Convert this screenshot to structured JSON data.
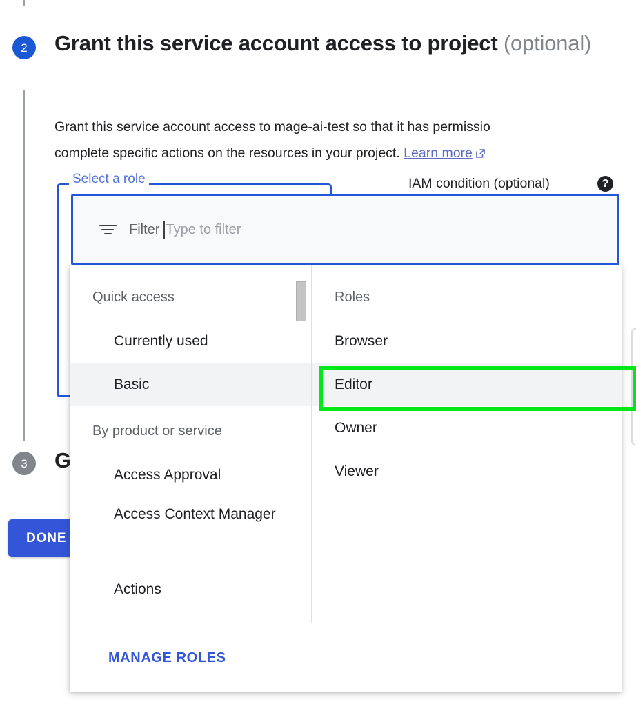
{
  "steps": {
    "step2_number": "2",
    "step3_number": "3",
    "step2_title": "Grant this service account access to project",
    "step2_title_optional": "(optional)",
    "step2_description_line1": "Grant this service account access to mage-ai-test so that it has permissio",
    "step2_description_line2": "complete specific actions on the resources in your project.",
    "learn_more_label": "Learn more",
    "step3_title_visible": "G"
  },
  "role_field": {
    "label": "Select a role",
    "iam_condition_label": "IAM condition (optional)",
    "help_icon": "help-icon"
  },
  "filter": {
    "icon": "filter-icon",
    "label": "Filter",
    "placeholder": "Type to filter",
    "value": ""
  },
  "dropdown": {
    "left_column": {
      "groups": [
        {
          "header": "Quick access",
          "items": [
            {
              "label": "Currently used",
              "selected": false
            },
            {
              "label": "Basic",
              "selected": true
            }
          ]
        },
        {
          "header": "By product or service",
          "items": [
            {
              "label": "Access Approval",
              "selected": false
            },
            {
              "label": "Access Context Manager",
              "selected": false,
              "wrap": true
            },
            {
              "label": "Actions",
              "selected": false
            }
          ]
        }
      ]
    },
    "right_column": {
      "header": "Roles",
      "items": [
        {
          "label": "Browser",
          "selected": false
        },
        {
          "label": "Editor",
          "selected": true
        },
        {
          "label": "Owner",
          "selected": false
        },
        {
          "label": "Viewer",
          "selected": false
        }
      ]
    },
    "footer": {
      "manage_roles_label": "MANAGE ROLES"
    }
  },
  "buttons": {
    "done_label": "DONE"
  },
  "annotation": {
    "highlight_target": "Editor",
    "highlight_color": "#00e818"
  },
  "colors": {
    "primary_blue": "#3355d8",
    "step_active": "#1b59d4",
    "step_inactive": "#80868b",
    "link": "#5c6bc0",
    "selected_row": "#f1f3f4",
    "muted_text": "#5f6368",
    "placeholder": "#9aa0a6"
  }
}
